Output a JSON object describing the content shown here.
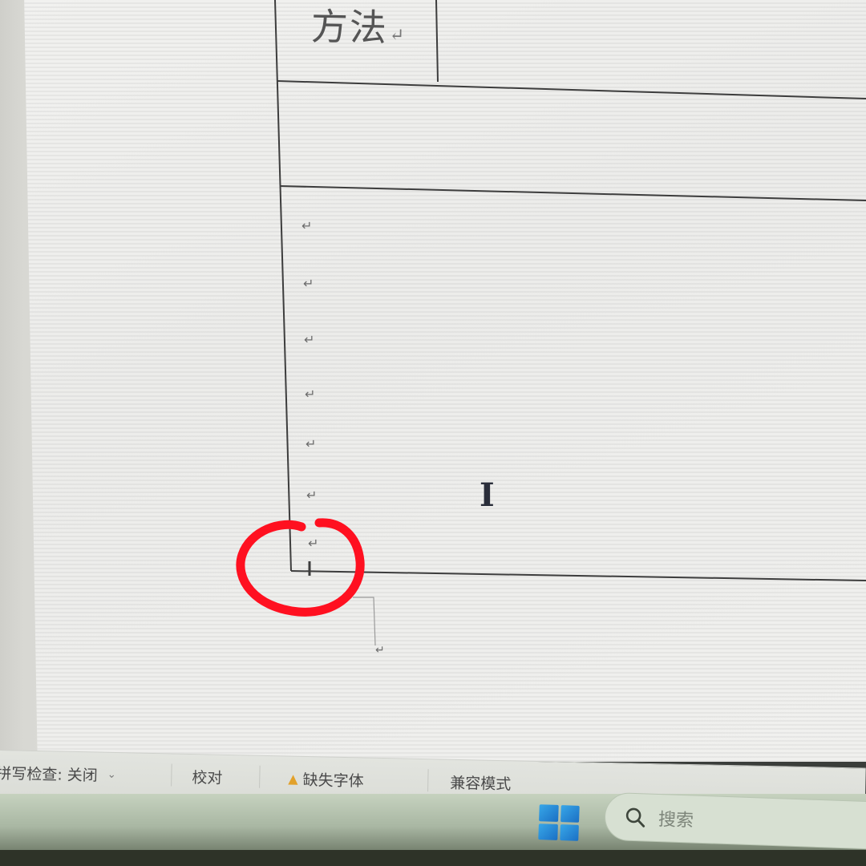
{
  "document": {
    "header_cell_text": "方法",
    "paragraph_mark": "↵",
    "paragraph_marks_count_in_cell": 7,
    "cursor_glyph": "I",
    "annotation_color": "#ff1020"
  },
  "statusbar": {
    "spell_check": "拼写检查: 关闭",
    "proofing": "校对",
    "missing_fonts": "缺失字体",
    "compat_mode": "兼容模式",
    "warn_icon": "warning-triangle-icon"
  },
  "taskbar": {
    "start_icon": "windows-start-icon",
    "search_icon": "magnifier-icon",
    "search_placeholder": "搜索"
  }
}
